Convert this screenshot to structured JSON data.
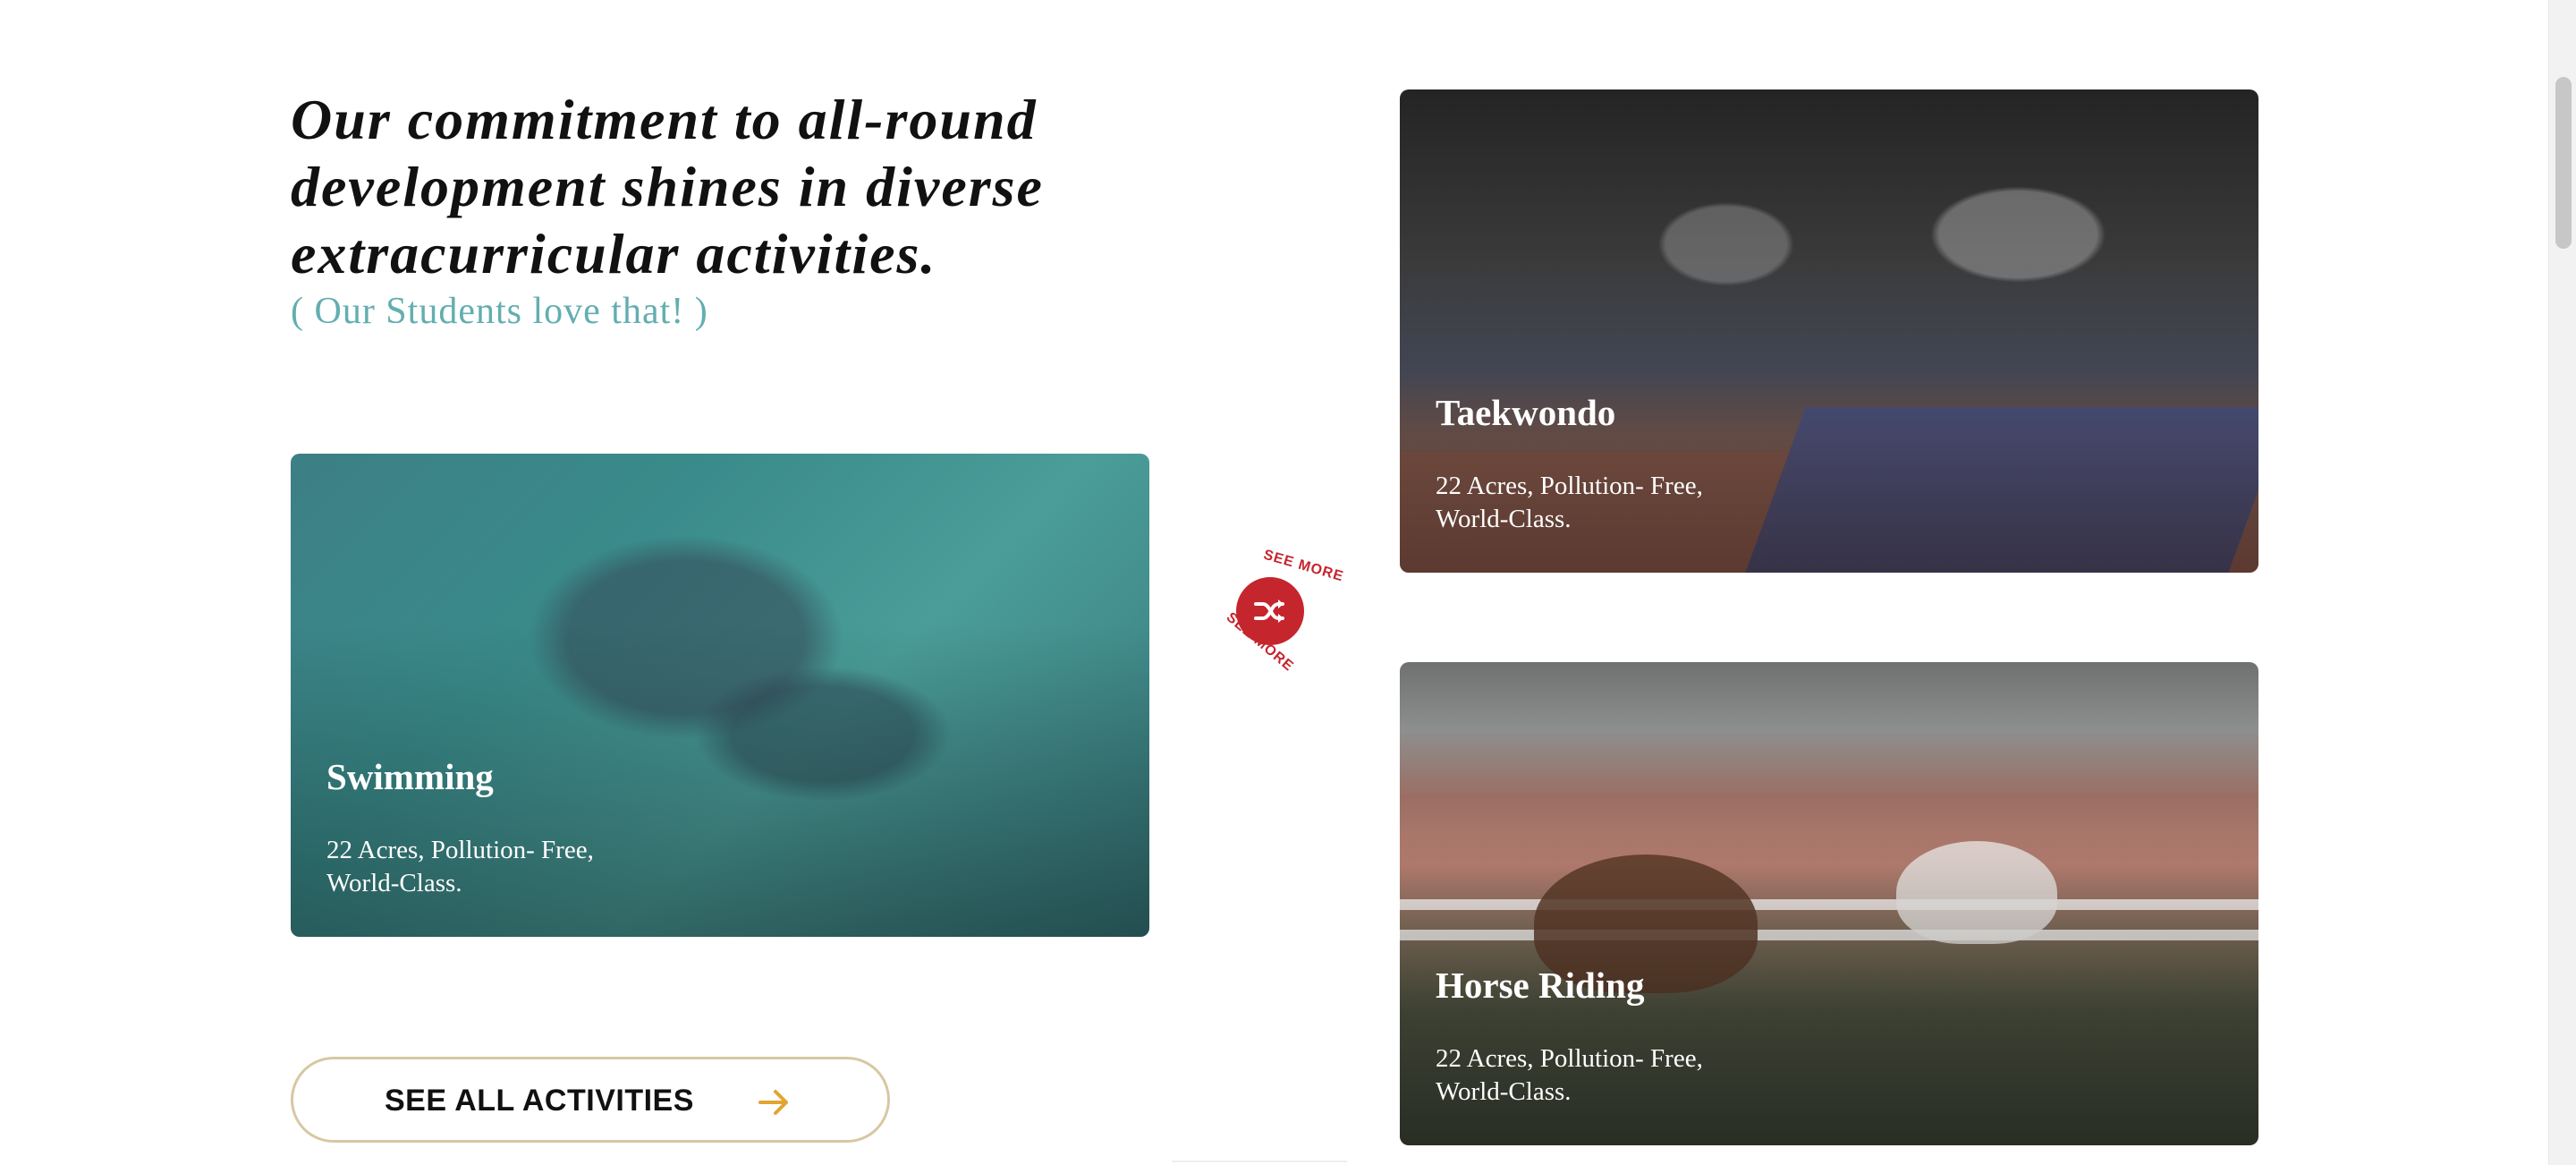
{
  "headline": "Our commitment to all-round development shines in diverse extracurricular activities.",
  "subhead": "( Our Students love that! )",
  "activities": [
    {
      "title": "Taekwondo",
      "description": "22 Acres, Pollution- Free, World-Class."
    },
    {
      "title": "Swimming",
      "description": "22 Acres, Pollution- Free, World-Class."
    },
    {
      "title": "Horse Riding",
      "description": "22 Acres, Pollution- Free, World-Class."
    }
  ],
  "see_more": {
    "label": "SEE MORE",
    "icon": "shuffle-icon",
    "color": "#c5252d"
  },
  "cta": {
    "label": "SEE ALL ACTIVITIES",
    "icon": "arrow-right-icon",
    "accent": "#e2a531",
    "border_color": "#d8c7a2"
  },
  "colors": {
    "headline": "#111111",
    "subhead": "#63aeb0"
  }
}
